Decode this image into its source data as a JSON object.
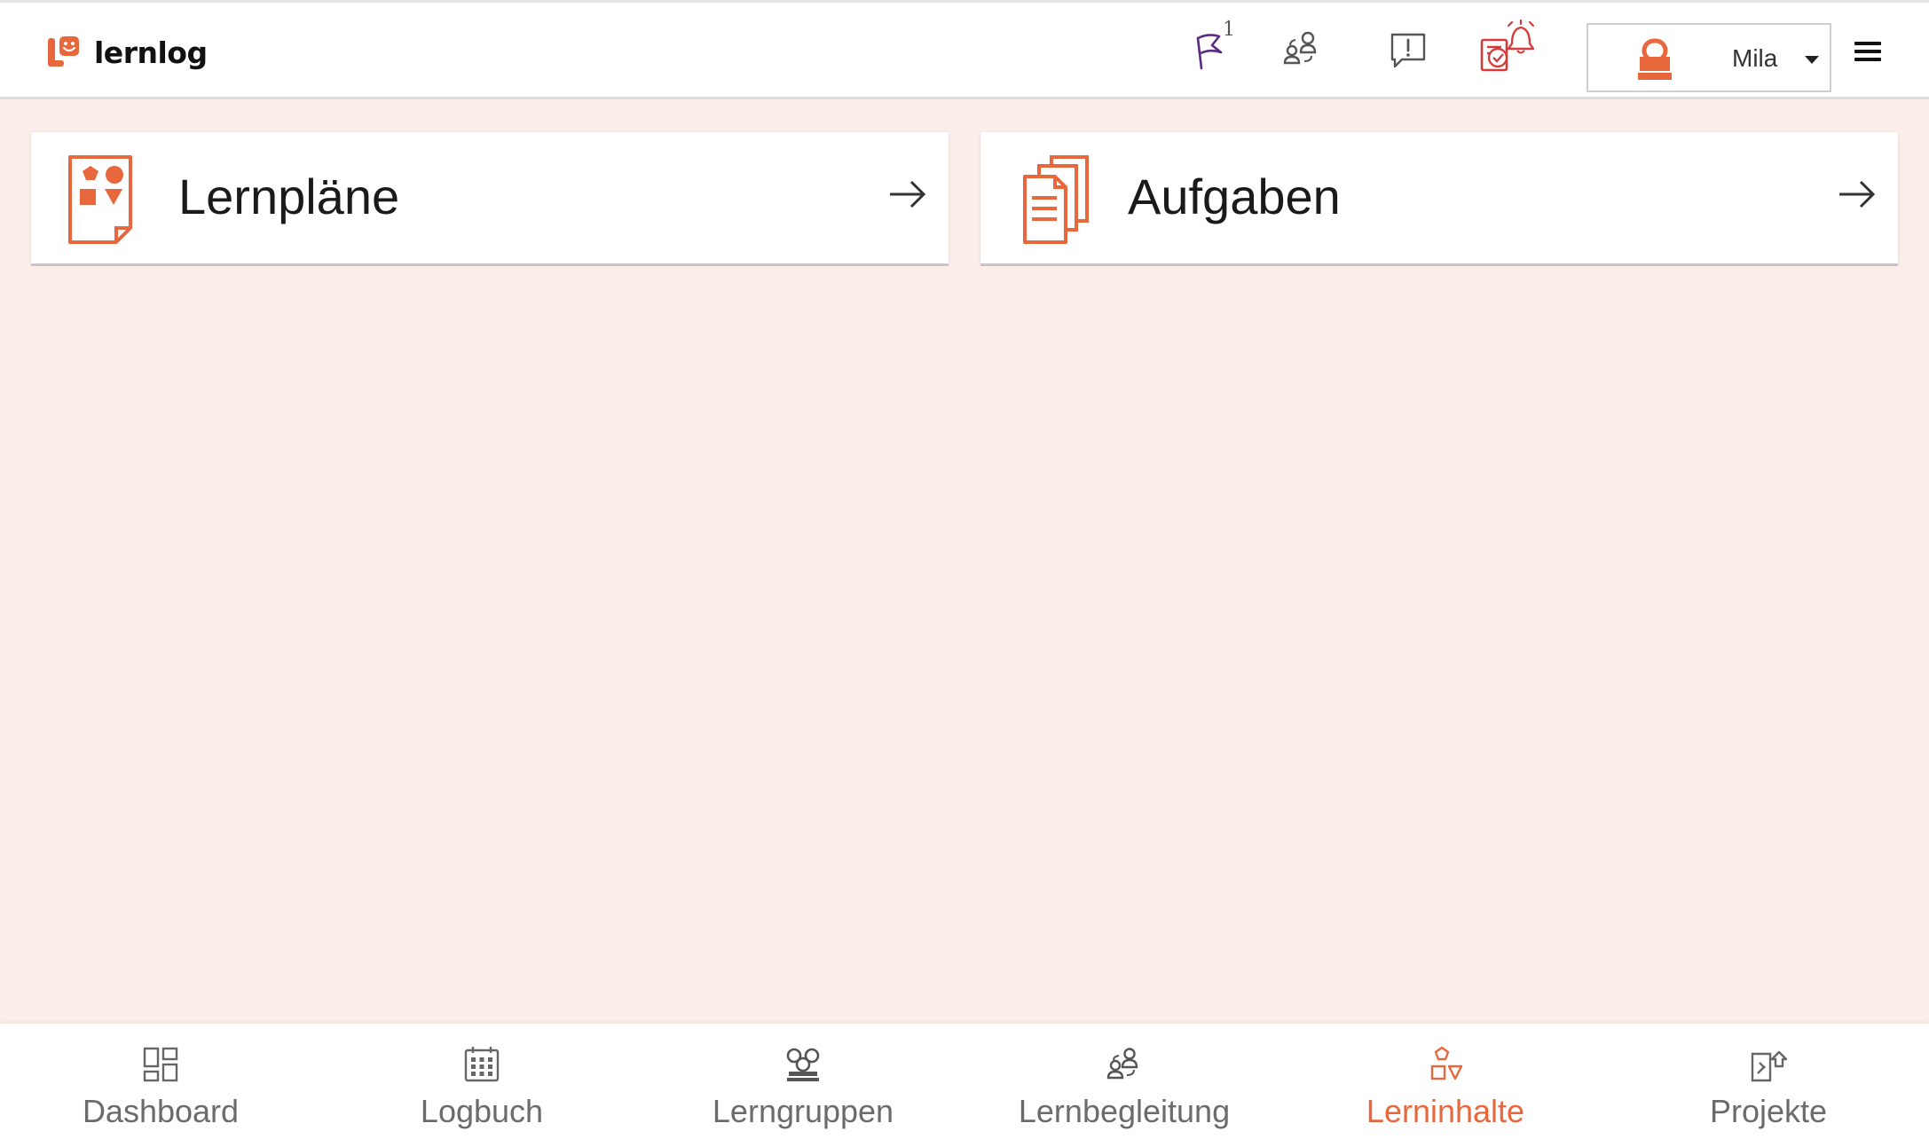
{
  "app": {
    "name": "lernlog"
  },
  "colors": {
    "accent": "#e8673c",
    "background": "#fbeeea",
    "flag": "#5b2a86",
    "alert": "#d63b3b",
    "muted": "#6b6b6b"
  },
  "header": {
    "flag_count": "1",
    "icons": [
      "flag-icon",
      "lernbegleitung-icon",
      "feedback-icon",
      "reminder-bell-icon"
    ],
    "user": {
      "name": "Mila"
    }
  },
  "cards": [
    {
      "title": "Lernpläne",
      "icon": "lernplan-icon"
    },
    {
      "title": "Aufgaben",
      "icon": "aufgaben-icon"
    }
  ],
  "nav": {
    "active": "Lerninhalte",
    "items": [
      {
        "label": "Dashboard",
        "icon": "dashboard-icon"
      },
      {
        "label": "Logbuch",
        "icon": "calendar-icon"
      },
      {
        "label": "Lerngruppen",
        "icon": "groups-icon"
      },
      {
        "label": "Lernbegleitung",
        "icon": "lernbegleitung-icon"
      },
      {
        "label": "Lerninhalte",
        "icon": "shapes-icon"
      },
      {
        "label": "Projekte",
        "icon": "projects-icon"
      }
    ]
  }
}
